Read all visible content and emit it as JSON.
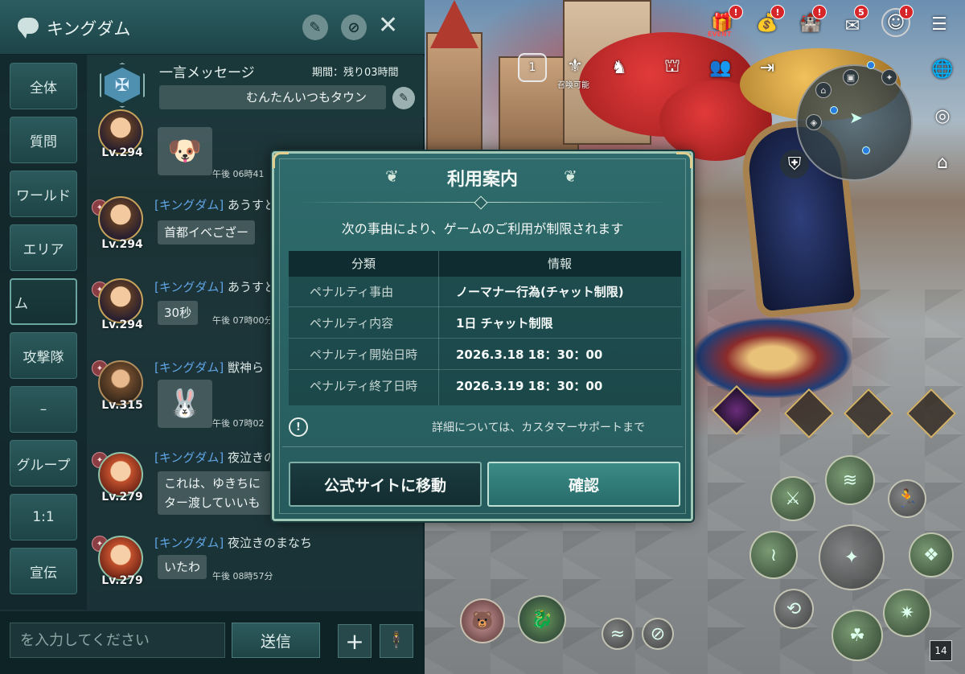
{
  "chat": {
    "title": "キングダム",
    "tabs": [
      "全体",
      "質問",
      "ワールド",
      "エリア",
      "ム",
      "攻撃隊",
      "–",
      "グループ",
      "1:1",
      "宣伝"
    ],
    "notice": {
      "title": "一言メッセージ",
      "period": "期間：残り03時間",
      "message": "むんたんいつもタウン"
    },
    "messages": [
      {
        "level": "Lv.294",
        "sticker": "🐶",
        "time": "午後 06時41"
      },
      {
        "level": "Lv.294",
        "tag": "[キングダム]",
        "name": "あうすとら",
        "text": "首都イベござー",
        "time": ""
      },
      {
        "level": "Lv.294",
        "tag": "[キングダム]",
        "name": "あうすとら",
        "text": "30秒",
        "time": "午後 07時00分"
      },
      {
        "level": "Lv.315",
        "tag": "[キングダム]",
        "name": "獣神ら",
        "sticker": "🐰",
        "time": "午後 07時02"
      },
      {
        "level": "Lv.279",
        "tag": "[キングダム]",
        "name": "夜泣きのまなち",
        "text": "これは、ゆきちに\nター渡していいも",
        "time": ""
      },
      {
        "level": "Lv.279",
        "tag": "[キングダム]",
        "name": "夜泣きのまなち",
        "text": "いたわ",
        "time": "午後 08時57分"
      }
    ],
    "input_placeholder": "を入力してください",
    "send_label": "送信",
    "plus_label": "+"
  },
  "modal": {
    "title": "利用案内",
    "subtitle": "次の事由により、ゲームのご利用が制限されます",
    "table_headers": [
      "分類",
      "情報"
    ],
    "rows": [
      {
        "key": "ペナルティ事由",
        "value": "ノーマナー行為(チャット制限)"
      },
      {
        "key": "ペナルティ内容",
        "value": "1日 チャット制限"
      },
      {
        "key": "ペナルティ開始日時",
        "value": "2026.3.18 18：30：00"
      },
      {
        "key": "ペナルティ終了日時",
        "value": "2026.3.19 18：30：00"
      }
    ],
    "info_text": "詳細については、カスタマーサポートまで",
    "info_icon": "!",
    "buttons": {
      "official_site": "公式サイトに移動",
      "confirm": "確認"
    }
  },
  "hud": {
    "badges": {
      "event": "!",
      "gift": "!",
      "alert": "!",
      "mail": "5",
      "character": "!"
    },
    "event_label": "EVENT",
    "calendar_day": "1",
    "summon_label": "召喚可能",
    "level_box": "14"
  },
  "colors": {
    "panel": "#1d4448",
    "accent": "#6ba5a2",
    "clan_tag": "#5fa4e4",
    "badge": "#d6262a"
  }
}
